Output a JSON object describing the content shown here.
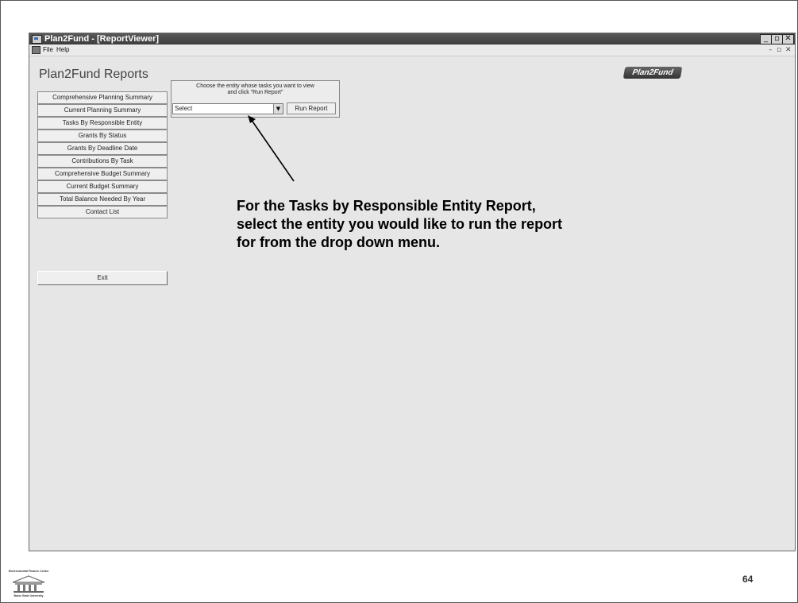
{
  "window": {
    "title": "Plan2Fund - [ReportViewer]",
    "controls": [
      "_",
      "▫",
      "✕"
    ]
  },
  "menu": {
    "items": [
      "File",
      "Help"
    ],
    "mdi_controls": [
      "–",
      "▫",
      "✕"
    ]
  },
  "sidebar": {
    "title": "Plan2Fund Reports",
    "items": [
      {
        "label": "Comprehensive Planning Summary"
      },
      {
        "label": "Current Planning Summary"
      },
      {
        "label": "Tasks By Responsible Entity"
      },
      {
        "label": "Grants By Status"
      },
      {
        "label": "Grants By Deadline Date"
      },
      {
        "label": "Contributions By Task"
      },
      {
        "label": "Comprehensive Budget Summary"
      },
      {
        "label": "Current Budget Summary"
      },
      {
        "label": "Total Balance Needed By Year"
      },
      {
        "label": "Contact List"
      }
    ],
    "exit_label": "Exit"
  },
  "entity_panel": {
    "instruction_line1": "Choose the entity whose tasks you want to view",
    "instruction_line2": "and click \"Run Report\"",
    "select_value": "Select",
    "run_label": "Run Report"
  },
  "brand": {
    "logo_text": "Plan2Fund"
  },
  "callout": {
    "text": "For the Tasks by Responsible Entity Report, select the entity you would like to run the report for from the drop down menu."
  },
  "footer": {
    "org_top": "Environmental Finance Center",
    "org_bottom": "Boise State University",
    "page_number": "64"
  }
}
